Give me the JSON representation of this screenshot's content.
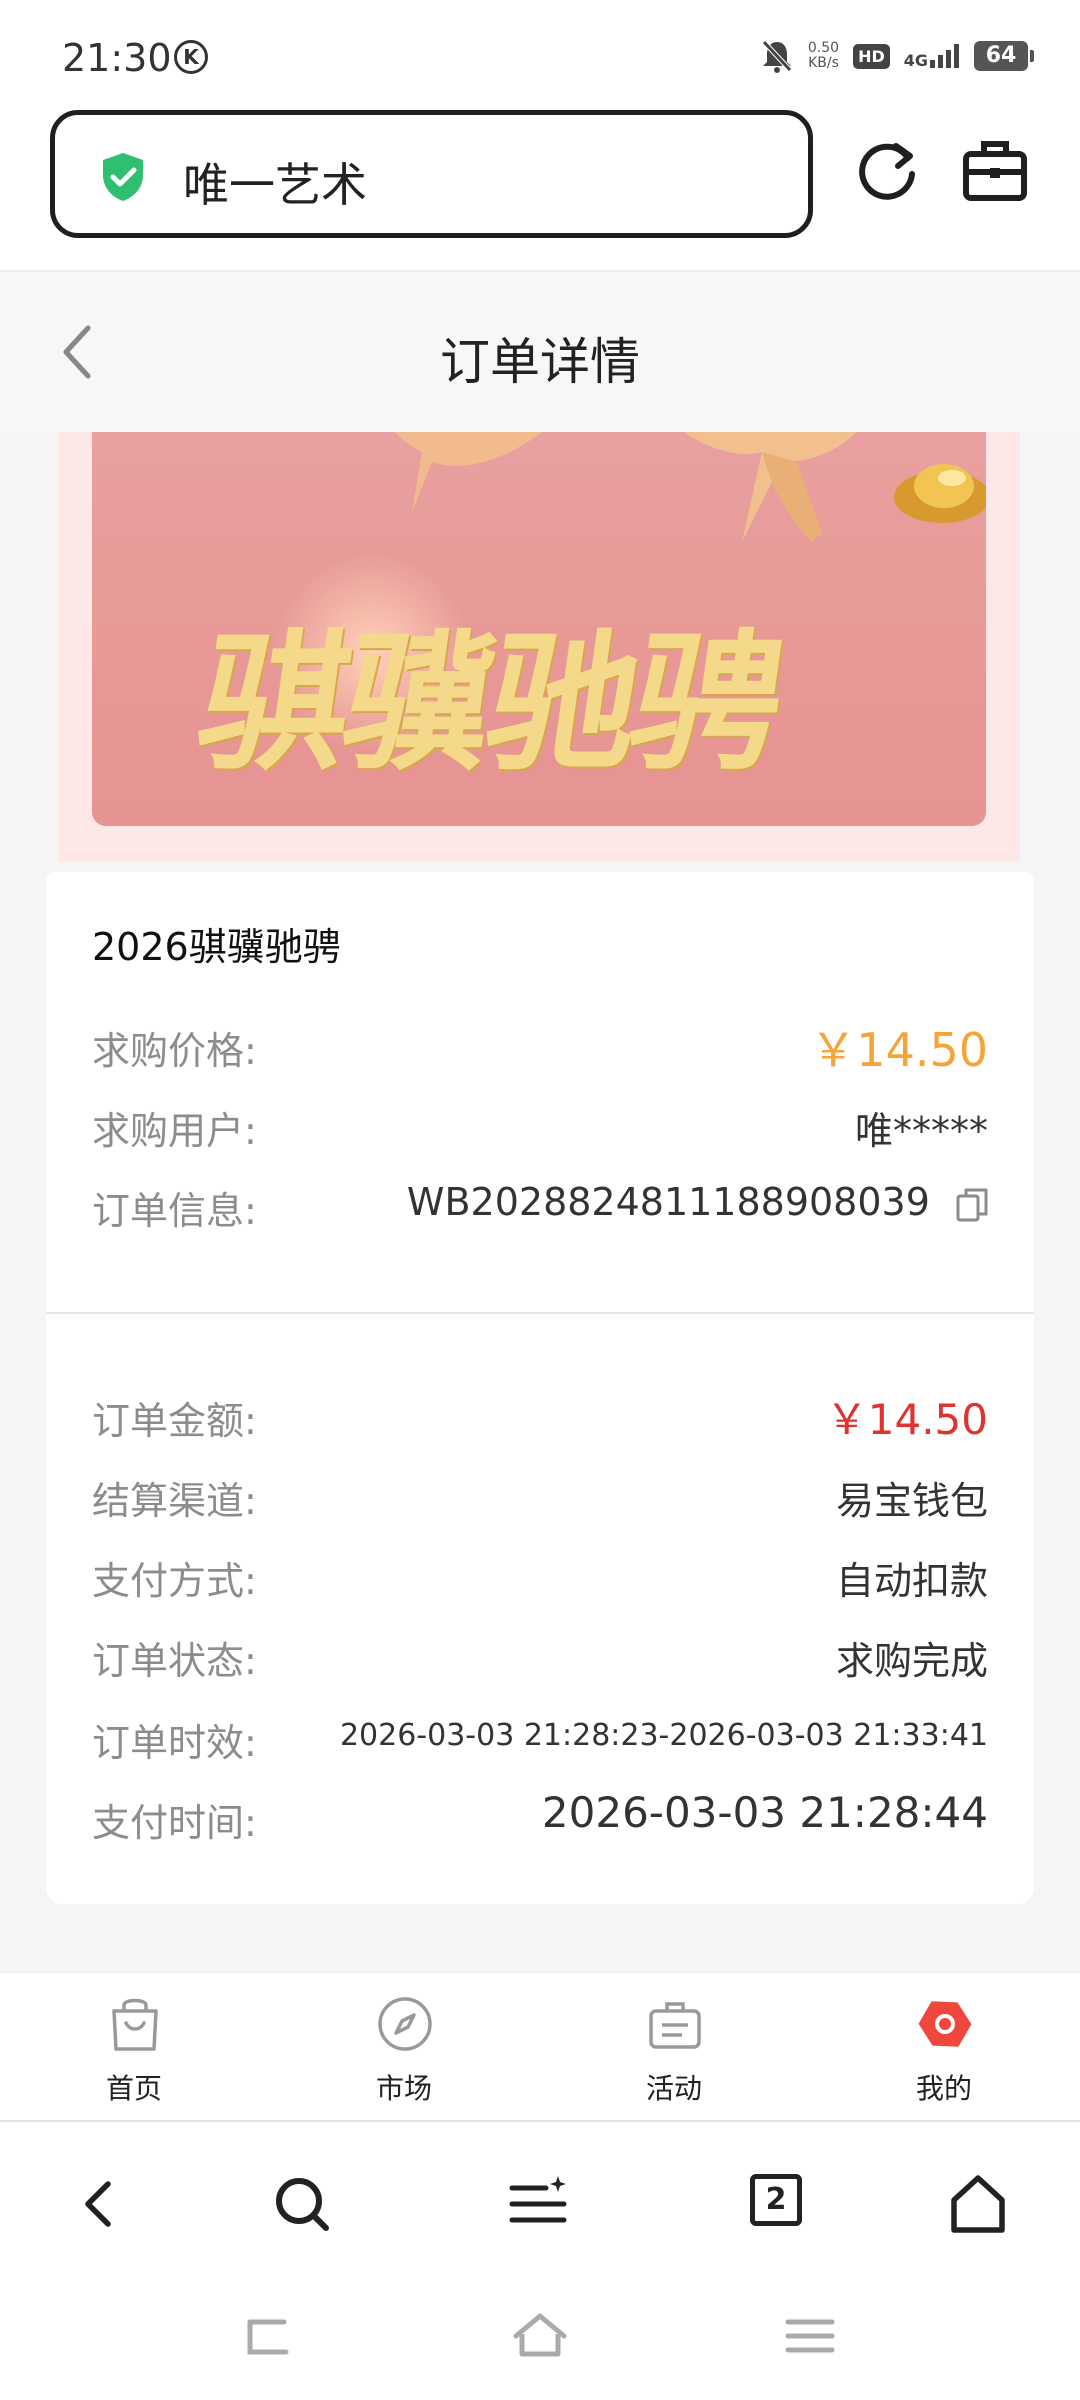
{
  "status_bar": {
    "time": "21:30",
    "k_badge": "K",
    "net_speed_value": "0.50",
    "net_speed_unit": "KB/s",
    "hd_label": "HD",
    "network": "4G",
    "battery": "64"
  },
  "browser": {
    "address_text": "唯一艺术",
    "tab_count": "2"
  },
  "page": {
    "title": "订单详情"
  },
  "banner": {
    "caption": "骐骥驰骋"
  },
  "order": {
    "item_name": "2026骐骥驰骋",
    "price_label": "求购价格:",
    "price_value": "￥14.50",
    "user_label": "求购用户:",
    "user_value": "唯*****",
    "info_label": "订单信息:",
    "info_value": "WB202882481118890803​9",
    "amount_label": "订单金额:",
    "amount_value": "￥14.50",
    "channel_label": "结算渠道:",
    "channel_value": "易宝钱包",
    "pay_method_label": "支付方式:",
    "pay_method_value": "自动扣款",
    "status_label": "订单状态:",
    "status_value": "求购完成",
    "validity_label": "订单时效:",
    "validity_value": "2026-03-03 21:28:23-2026-03-03 21:33:41",
    "pay_time_label": "支付时间:",
    "pay_time_value": "2026-03-03 21:28:44"
  },
  "app_nav": {
    "home": "首页",
    "market": "市场",
    "activity": "活动",
    "mine": "我的",
    "active_color": "#f0473c"
  },
  "colors": {
    "price_orange": "#f5a43a",
    "amount_red": "#e0322f",
    "shield_green": "#2fbf71"
  }
}
